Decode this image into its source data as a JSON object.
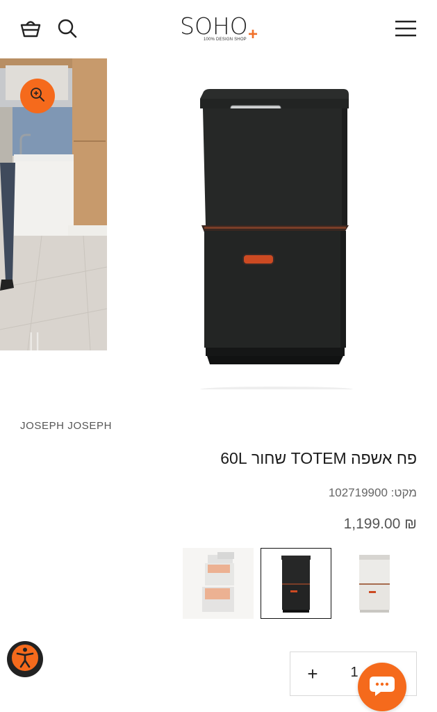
{
  "header": {
    "logo_text": "SOHO",
    "logo_plus": "+",
    "logo_tagline": "100% DESIGN SHOP",
    "icons": {
      "cart": "basket-icon",
      "search": "search-icon",
      "menu": "hamburger-menu-icon"
    }
  },
  "gallery": {
    "zoom_icon": "zoom-in-icon"
  },
  "product": {
    "brand": "JOSEPH JOSEPH",
    "title": "פח אשפה TOTEM שחור 60L",
    "sku": "מקט: 102719900",
    "price": "₪ 1,199.00"
  },
  "variants": [
    {
      "color": "#e57a44",
      "selected": false
    },
    {
      "color": "#2a2a2a",
      "selected": true
    },
    {
      "color": "#e9e6e1",
      "selected": false
    }
  ],
  "quantity": {
    "plus": "+",
    "value": "1"
  },
  "colors": {
    "accent": "#f56a1c"
  },
  "widgets": {
    "chat_icon": "chat-dots-icon",
    "accessibility_icon": "accessibility-icon"
  }
}
